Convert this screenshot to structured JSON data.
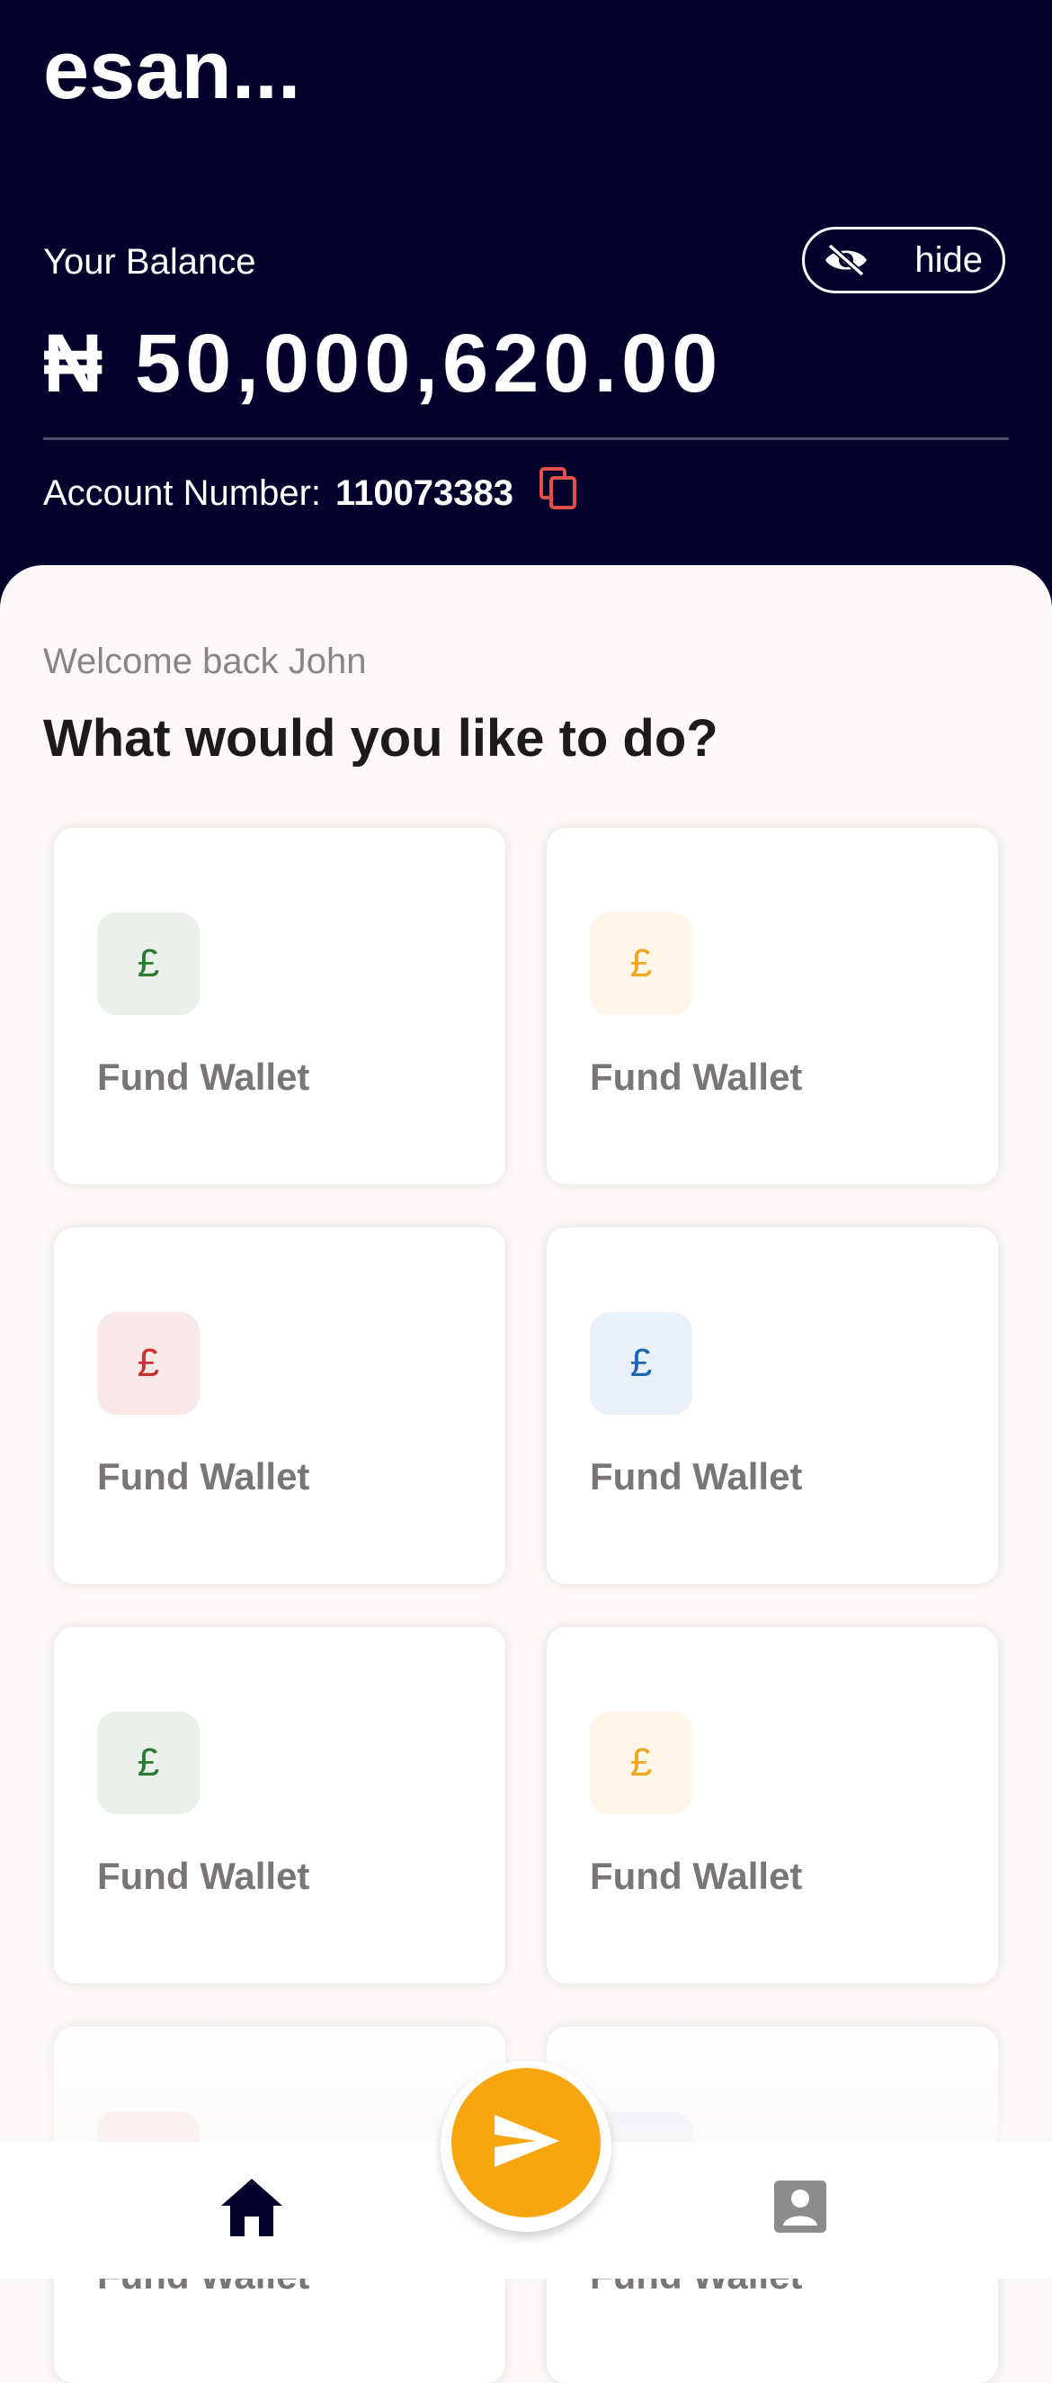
{
  "header": {
    "title": "esan...",
    "balance_label": "Your Balance",
    "hide_label": "hide",
    "balance": "₦ 50,000,620.00",
    "account_label": "Account Number:",
    "account_number": "110073383"
  },
  "main": {
    "welcome": "Welcome back John",
    "question": "What would you like to do?",
    "actions": [
      {
        "label": "Fund Wallet",
        "icon": "£",
        "tone": "green"
      },
      {
        "label": "Fund Wallet",
        "icon": "£",
        "tone": "yellow"
      },
      {
        "label": "Fund Wallet",
        "icon": "£",
        "tone": "red"
      },
      {
        "label": "Fund Wallet",
        "icon": "£",
        "tone": "blue"
      },
      {
        "label": "Fund Wallet",
        "icon": "£",
        "tone": "green"
      },
      {
        "label": "Fund Wallet",
        "icon": "£",
        "tone": "yellow"
      },
      {
        "label": "Fund Wallet",
        "icon": "£",
        "tone": "red"
      },
      {
        "label": "Fund Wallet",
        "icon": "£",
        "tone": "blue"
      }
    ]
  },
  "nav": {
    "home_icon": "home-icon",
    "send_icon": "send-icon",
    "profile_icon": "account-box-icon"
  },
  "colors": {
    "header_bg": "#02012b",
    "accent": "#f7a60e",
    "copy_icon": "#e2504a",
    "page_bg": "#fcf8f7"
  }
}
